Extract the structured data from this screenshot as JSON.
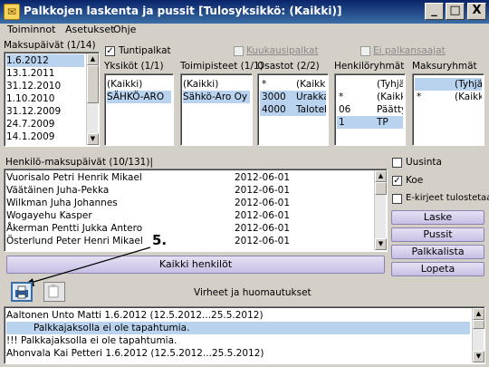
{
  "window": {
    "title": "Palkkojen laskenta ja pussit [Tulosyksikkö: (Kaikki)]",
    "min": "_",
    "max": "□",
    "close": "X"
  },
  "menu": [
    "Toiminnot",
    "Asetukset",
    "Ohje"
  ],
  "maksupaivat": {
    "label": "Maksupäivät (1/14)",
    "items": [
      "1.6.2012",
      "13.1.2011",
      "31.12.2010",
      "1.10.2010",
      "31.12.2009",
      "24.7.2009",
      "14.1.2009"
    ]
  },
  "checks": {
    "tuntipalkat": "Tuntipalkat",
    "kuukausipalkat": "Kuukausipalkat",
    "ei_palkansaajat": "Ei palkansaajat"
  },
  "yksikot": {
    "label": "Yksiköt (1/1)",
    "items": [
      "(Kaikki)",
      "SÄHKÖ-ARO"
    ]
  },
  "toimipisteet": {
    "label": "Toimipisteet (1/1)",
    "items": [
      "(Kaikki)",
      "Sähkö-Aro Oy"
    ]
  },
  "osastot": {
    "label": "Osastot (2/2)",
    "rows": [
      [
        "*",
        "(Kaikki)"
      ],
      [
        "3000",
        "Urakka"
      ],
      [
        "4000",
        "Talotek"
      ]
    ]
  },
  "henkiloryhmat": {
    "label": "Henkilöryhmät",
    "rows": [
      [
        "",
        "(Tyhjä)"
      ],
      [
        "*",
        "(Kaikki)"
      ],
      [
        "06",
        "Päättyr"
      ],
      [
        "1",
        "TP"
      ]
    ]
  },
  "maksuryhmat": {
    "label": "Maksuryhmät",
    "rows": [
      [
        "",
        "(Tyhjä)"
      ],
      [
        "*",
        "(Kaikki)"
      ]
    ]
  },
  "henkilot": {
    "label": "Henkilö-maksupäivät (10/131)|",
    "rows": [
      [
        "Vuorisalo Petri Henrik Mikael",
        "2012-06-01"
      ],
      [
        "Väätäinen Juha-Pekka",
        "2012-06-01"
      ],
      [
        "Wilkman Juha Johannes",
        "2012-06-01"
      ],
      [
        "Wogayehu Kasper",
        "2012-06-01"
      ],
      [
        "Åkerman Pentti Jukka Antero",
        "2012-06-01"
      ],
      [
        "Österlund Peter Henri Mikael",
        "2012-06-01"
      ]
    ]
  },
  "options": {
    "uusinta": "Uusinta",
    "koe": "Koe",
    "ekirjeet": "E-kirjeet tulostetaan"
  },
  "buttons": {
    "laske": "Laske",
    "pussit": "Pussit",
    "palkkalista": "Palkkalista",
    "lopeta": "Lopeta",
    "kaikki": "Kaikki henkilöt"
  },
  "annotation": "5.",
  "errors": {
    "label": "Virheet ja huomautukset",
    "lines": [
      "Aaltonen Unto Matti  1.6.2012  (12.5.2012...25.5.2012)",
      "Palkkajaksolla ei ole tapahtumia.",
      "!!! Palkkajaksolla ei ole tapahtumia.",
      "Ahonvala Kai Petteri  1.6.2012  (12.5.2012...25.5.2012)"
    ]
  }
}
